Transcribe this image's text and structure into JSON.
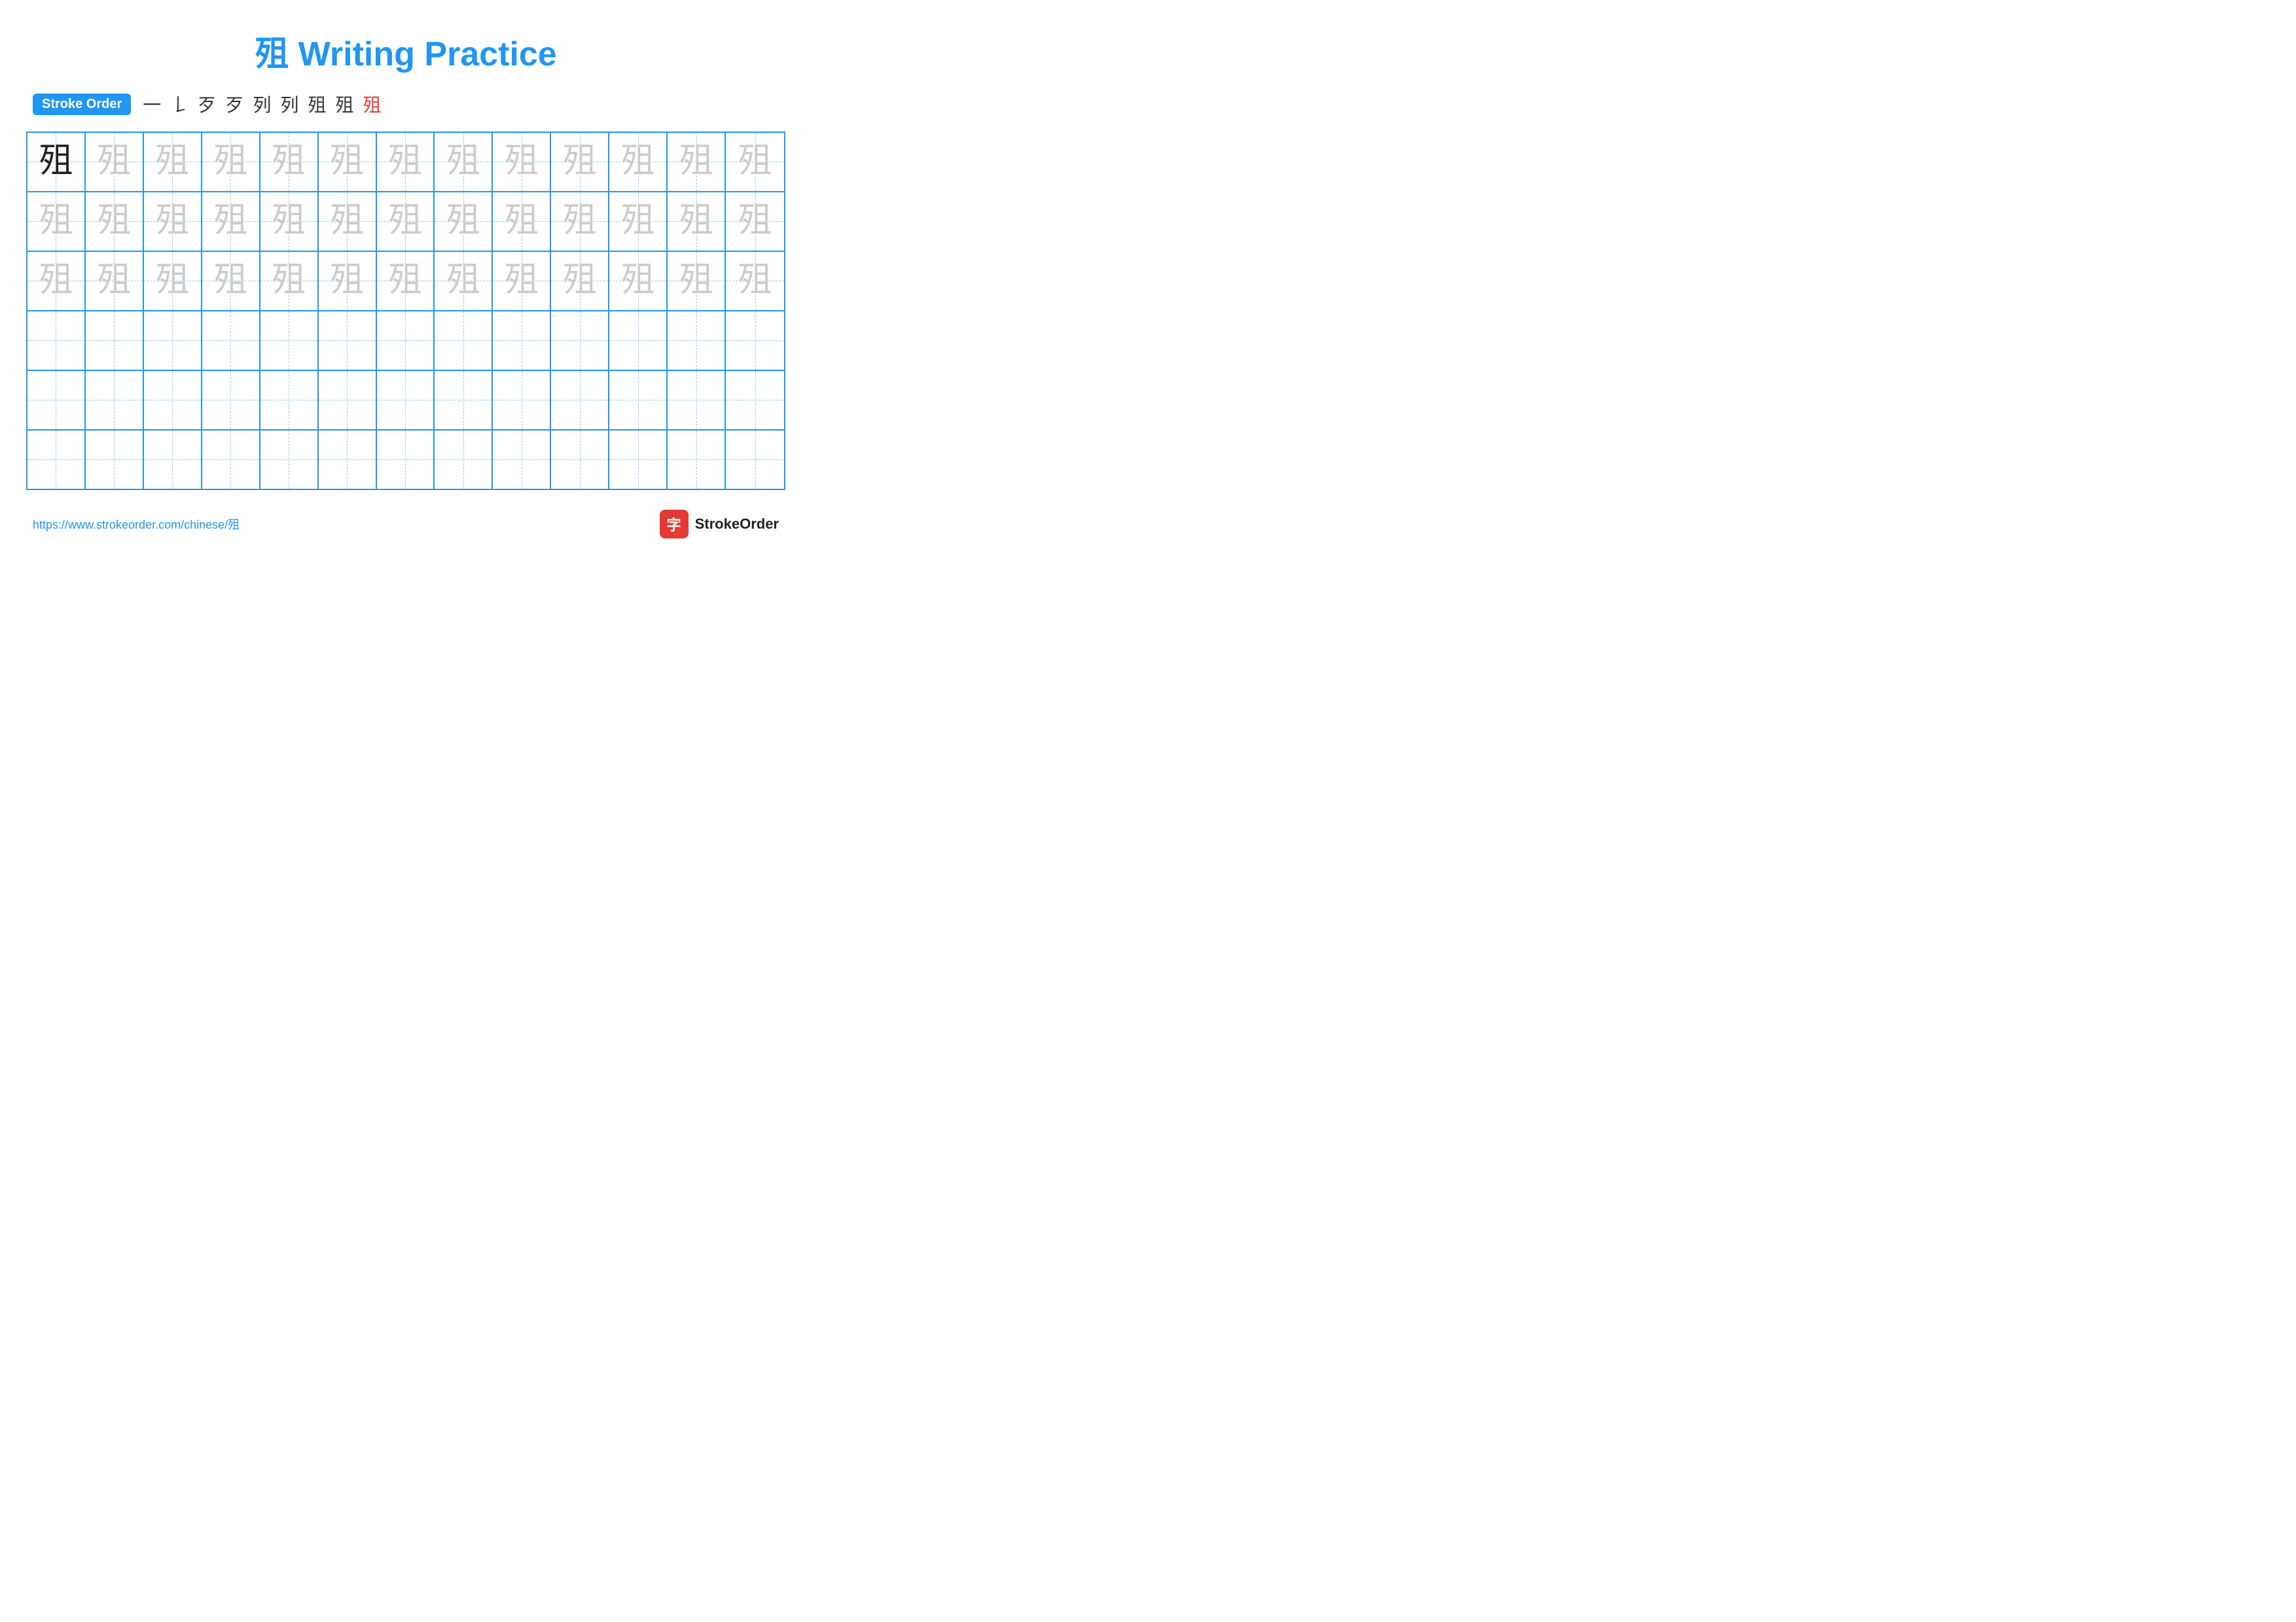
{
  "page": {
    "title": "殂 Writing Practice",
    "url": "https://www.strokeorder.com/chinese/殂",
    "brand": "StrokeOrder",
    "brand_char": "字"
  },
  "stroke_order": {
    "label": "Stroke Order",
    "steps": [
      "一",
      "𠄌",
      "歹",
      "歹",
      "列",
      "列",
      "𣦶",
      "殂",
      "殂"
    ],
    "red_index": 8
  },
  "grid": {
    "rows": 6,
    "cols": 13,
    "character": "殂",
    "row_types": [
      "dark-then-light",
      "light",
      "light",
      "empty",
      "empty",
      "empty"
    ]
  },
  "colors": {
    "blue": "#2196F3",
    "red": "#e53935",
    "light_char": "#cccccc",
    "dark_char": "#222222",
    "dashed": "#90CAF9"
  }
}
